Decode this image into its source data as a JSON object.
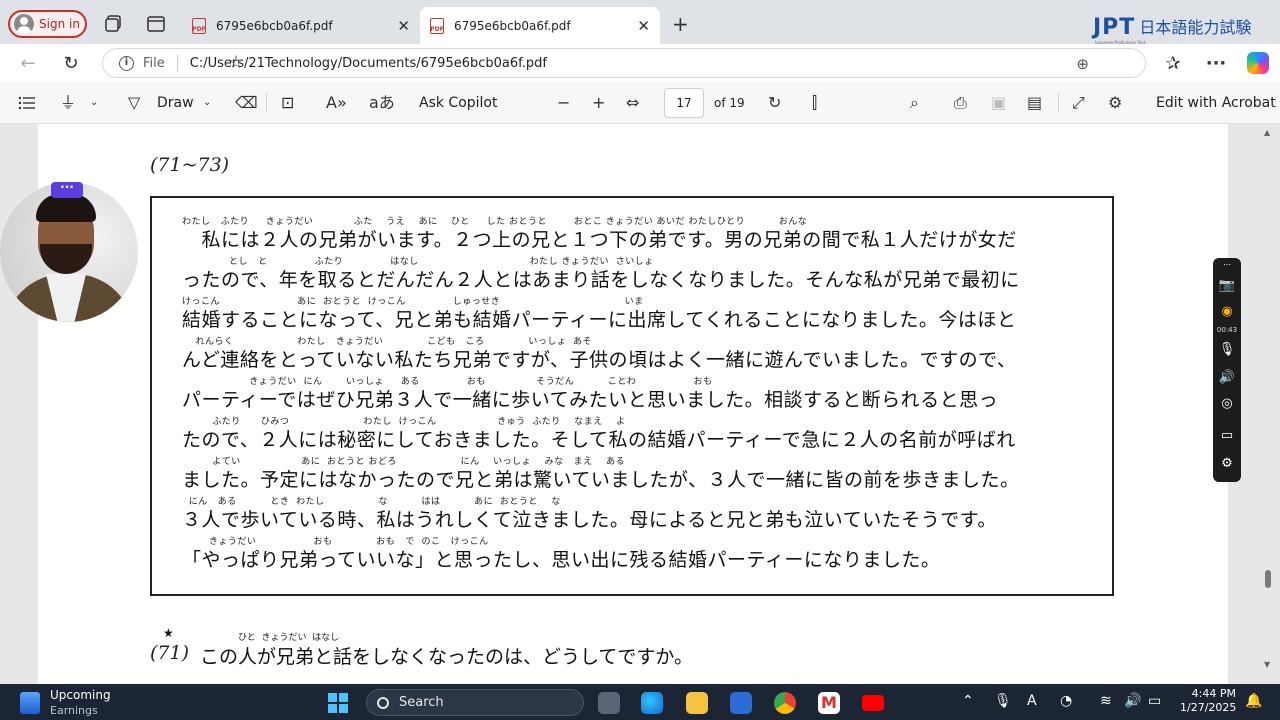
{
  "browser": {
    "sign_in": "Sign in",
    "tabs": [
      {
        "title": "6795e6bcb0a6f.pdf",
        "active": false
      },
      {
        "title": "6795e6bcb0a6f.pdf",
        "active": true
      }
    ],
    "file_label": "File",
    "url": "C:/Users/21Technology/Documents/6795e6bcb0a6f.pdf"
  },
  "watermark": {
    "brand": "JPT",
    "brand_ja": "日本語能力試験",
    "brand_sub": "Japanese Proficiency Test"
  },
  "pdf_toolbar": {
    "draw": "Draw",
    "ask_copilot": "Ask Copilot",
    "page_current": "17",
    "page_total": "of 19",
    "edit_acrobat": "Edit with Acrobat"
  },
  "document": {
    "question_range": "(71~73)",
    "passage_lines": [
      {
        "ruby": "わたし   ふたり     きょうだい            ふた    うえ    あに    ひと     した おとうと        おとこ きょうだい あいだ わたしひとり          おんな",
        "text": "　私には２人の兄弟がいます。２つ上の兄と１つ下の弟です。男の兄弟の間で私１人だけが女だ"
      },
      {
        "ruby": "              とし   と              ふたり              はなし                                 わたし きょうだい  さいしょ",
        "text": "ったので、年を取るとだんだん２人とはあまり話をしなくなりました。そんな私が兄弟で最初に"
      },
      {
        "ruby": "けっこん                       あに  おとうと  けっこん              しゅっせき                                     いま",
        "text": "結婚することになって、兄と弟も結婚パーティーに出席してくれることになりました。今はほと"
      },
      {
        "ruby": "    れんらく                   わたし   きょうだい             こども   ころ             いっしょ  あそ",
        "text": "んど連絡をとっていない私たち兄弟ですが、子供の頃はよく一緒に遊んでいました。ですので、"
      },
      {
        "ruby": "                    きょうだい  にん       いっしょ     ある              おも               そうだん          ことわ                 おも",
        "text": "パーティーではぜひ兄弟３人で一緒に歩いてみたいと思いました。相談すると断られると思っ"
      },
      {
        "ruby": "         ふたり      ひみつ                      わたし  けっこん                  きゅう  ふたり    なまえ    よ",
        "text": "たので、２人には秘密にしておきました。そして私の結婚パーティーで急に２人の名前が呼ばれ"
      },
      {
        "ruby": "         よてい                  あに  おとうと おどろ                   にん    いっしょ    みな   まえ    ある",
        "text": "ました。予定にはなかったので兄と弟は驚いていましたが、３人で一緒に皆の前を歩きました。"
      },
      {
        "ruby": "  にん   ある          とき  わたし                な          はは          あに  おとうと    な",
        "text": "３人で歩いている時、私はうれしくて泣きました。母によると兄と弟も泣いていたそうです。"
      },
      {
        "ruby": "        きょうだい                 おも             おも   で  のこ   けっこん",
        "text": "「やっぱり兄弟っていいな」と思ったし、思い出に残る結婚パーティーになりました。"
      }
    ],
    "question_star": "★",
    "question_number": "(71)",
    "question_ruby": "ひと  きょうだい  はなし",
    "question_text": "この人が兄弟と話をしなくなったのは、どうしてですか。"
  },
  "recorder": {
    "time": "00:43"
  },
  "taskbar": {
    "widget_title": "Upcoming",
    "widget_sub": "Earnings",
    "search": "Search",
    "time": "4:44 PM",
    "date": "1/27/2025"
  }
}
